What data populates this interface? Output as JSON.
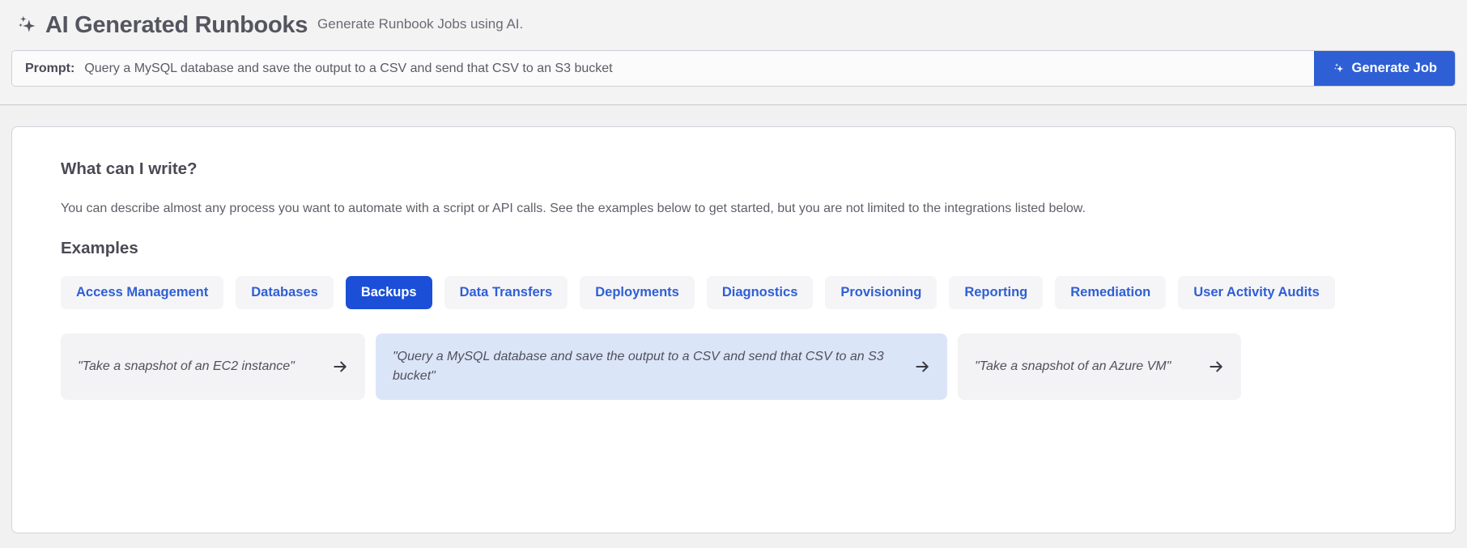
{
  "header": {
    "icon": "sparkle-icon",
    "title": "AI Generated Runbooks",
    "subtitle": "Generate Runbook Jobs using AI."
  },
  "prompt": {
    "label": "Prompt:",
    "value": "Query a MySQL database and save the output to a CSV and send that CSV to an S3 bucket",
    "placeholder": "Query a MySQL database and save the output to a CSV and send that CSV to an S3 bucket",
    "generate_button": {
      "label": "Generate Job",
      "icon": "sparkle-icon",
      "color": "#2f5fd4"
    }
  },
  "main": {
    "heading": "What can I write?",
    "description": "You can describe almost any process you want to automate with a script or API calls. See the examples below to get started, but you are not limited to the integrations listed below.",
    "examples_heading": "Examples",
    "categories": [
      {
        "label": "Access Management",
        "selected": false
      },
      {
        "label": "Databases",
        "selected": false
      },
      {
        "label": "Backups",
        "selected": true
      },
      {
        "label": "Data Transfers",
        "selected": false
      },
      {
        "label": "Deployments",
        "selected": false
      },
      {
        "label": "Diagnostics",
        "selected": false
      },
      {
        "label": "Provisioning",
        "selected": false
      },
      {
        "label": "Reporting",
        "selected": false
      },
      {
        "label": "Remediation",
        "selected": false
      },
      {
        "label": "User Activity Audits",
        "selected": false
      }
    ],
    "example_cards": [
      {
        "text": "\"Take a snapshot of an EC2 instance\"",
        "selected": false,
        "icon": "arrow-right-icon"
      },
      {
        "text": "\"Query a MySQL database and save the output to a CSV and send that CSV to an S3 bucket\"",
        "selected": true,
        "icon": "arrow-right-icon"
      },
      {
        "text": "\"Take a snapshot of an Azure VM\"",
        "selected": false,
        "icon": "arrow-right-icon"
      }
    ]
  },
  "colors": {
    "accent_blue": "#2f5fd4",
    "selected_chip_blue": "#1b4fd8",
    "selected_card_blue": "#dbe5f8",
    "page_bg": "#f1f1f2",
    "chip_bg": "#f5f5f7"
  }
}
